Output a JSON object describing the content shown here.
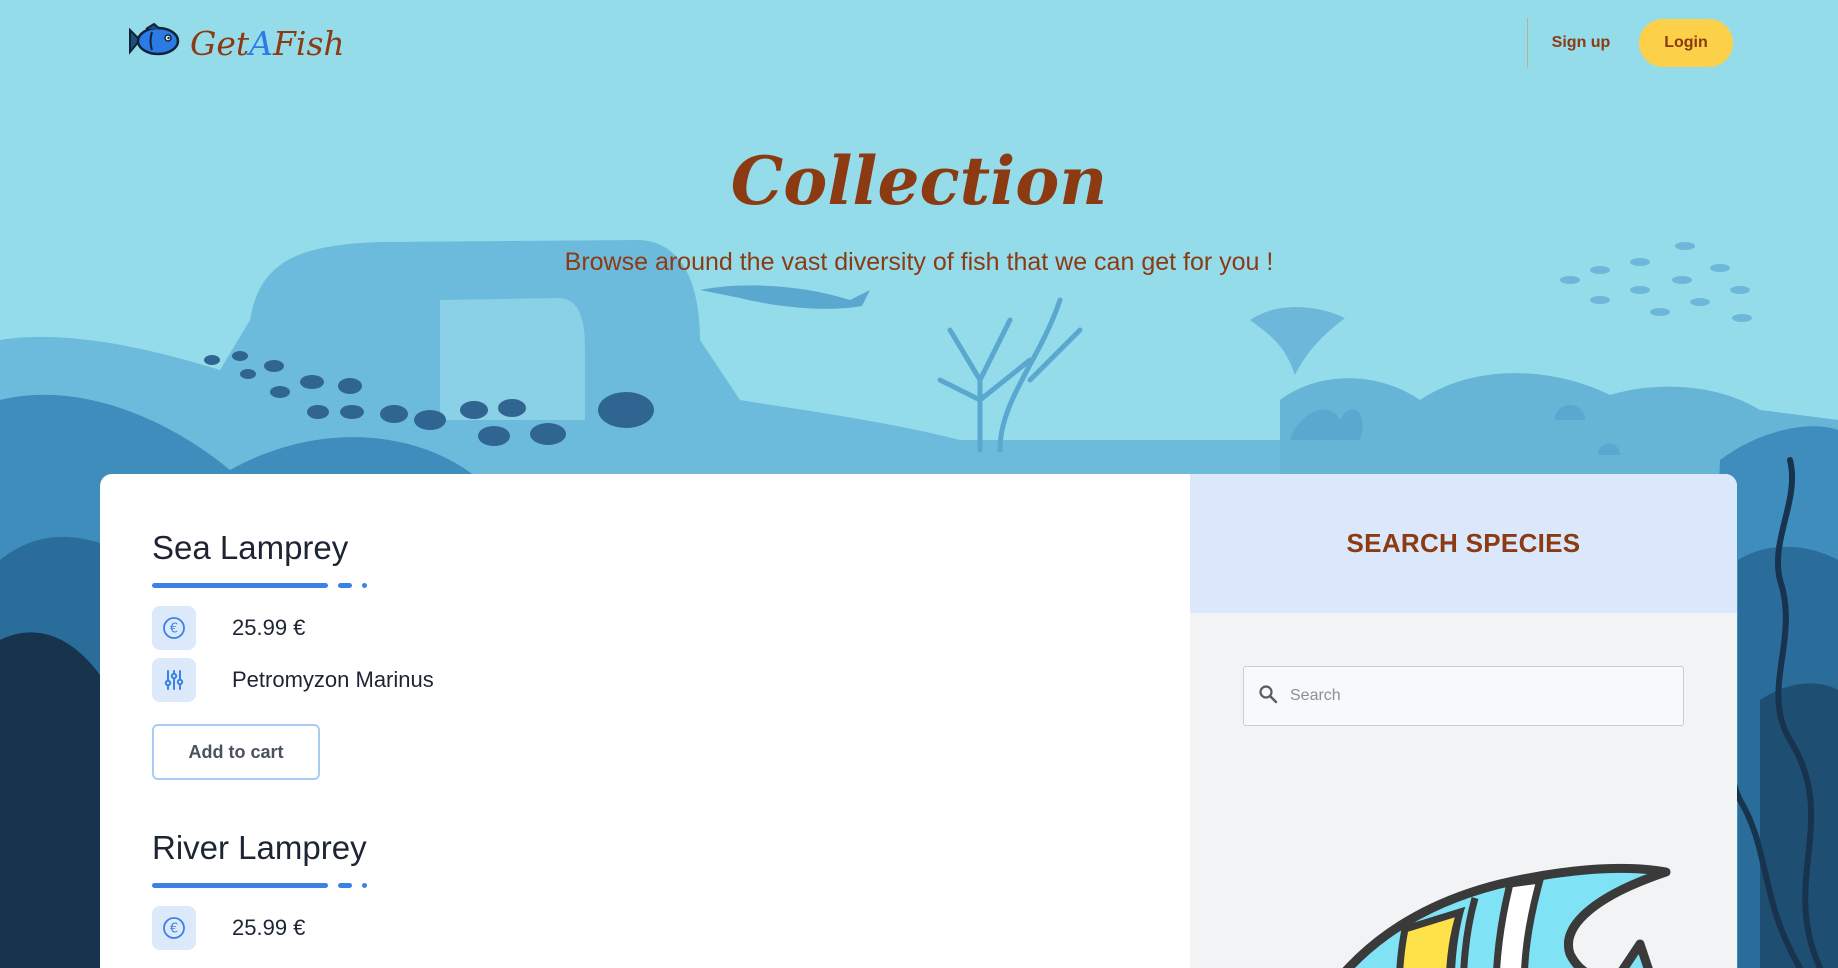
{
  "brand": {
    "name_part1": "Get",
    "name_accent": "A",
    "name_part2": "Fish"
  },
  "nav": {
    "signup_label": "Sign up",
    "login_label": "Login"
  },
  "hero": {
    "title": "Collection",
    "subtitle": "Browse around the vast diversity of fish that we can get for you !"
  },
  "products": [
    {
      "name": "Sea Lamprey",
      "price": "25.99 €",
      "species": "Petromyzon Marinus",
      "cart_label": "Add to cart"
    },
    {
      "name": "River Lamprey",
      "price": "25.99 €"
    }
  ],
  "sidebar": {
    "title": "SEARCH SPECIES",
    "search_placeholder": "Search"
  },
  "icons": {
    "logo": "fish-logo-icon",
    "price": "euro-icon",
    "species": "sliders-icon",
    "search": "search-icon"
  },
  "colors": {
    "sky": "#95dceb",
    "brand_brown": "#8b3a12",
    "accent_blue": "#3b82e6",
    "login_yellow": "#fcd048",
    "sidebar_head": "#dbe8fc"
  }
}
